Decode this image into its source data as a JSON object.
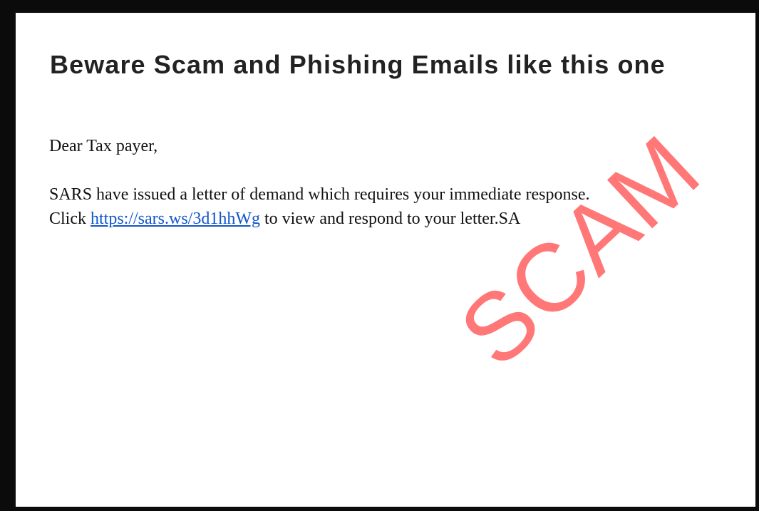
{
  "heading": "Beware Scam and Phishing Emails like this one",
  "email": {
    "greeting": "Dear Tax payer,",
    "line1": "SARS have issued a letter of demand which requires your immediate response.",
    "line2_prefix": "Click ",
    "link_text": "https://sars.ws/3d1hhWg",
    "line2_suffix": " to view and respond to your letter.SA"
  },
  "stamp": {
    "text": "SCAM",
    "color": "#ff5f5f"
  },
  "colors": {
    "frame": "#0b0b0b",
    "link": "#1155cc",
    "heading": "#222222"
  }
}
